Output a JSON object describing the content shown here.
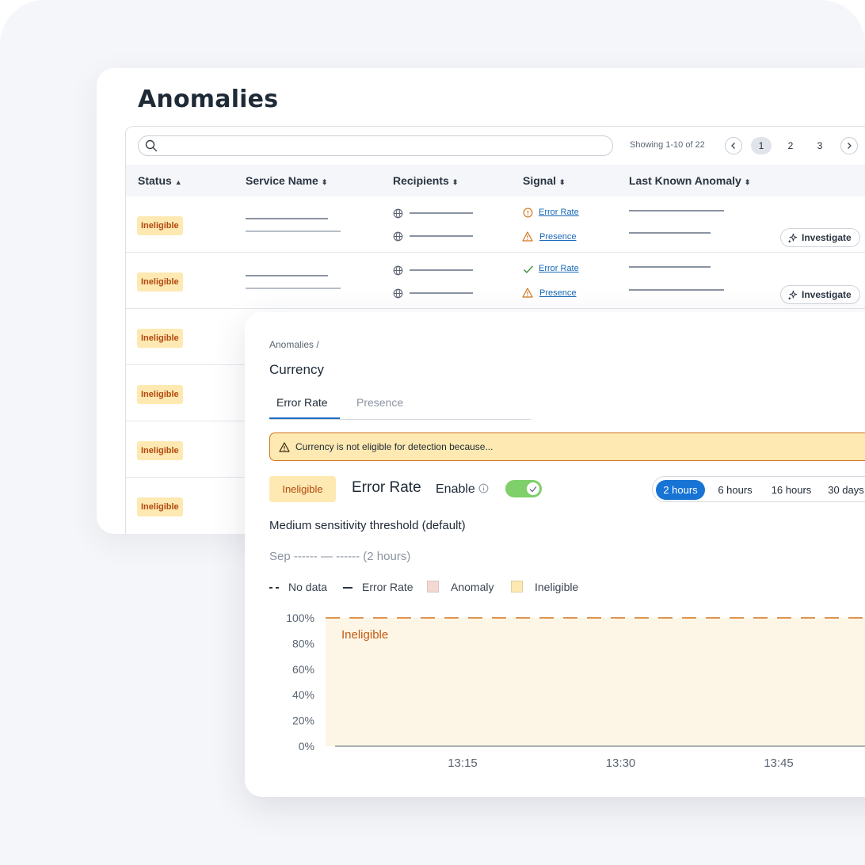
{
  "page": {
    "title": "Anomalies"
  },
  "table": {
    "search_placeholder": "",
    "showing_text": "Showing 1-10 of 22",
    "pages": [
      "1",
      "2",
      "3"
    ],
    "active_page": "1",
    "columns": [
      {
        "label": "Status",
        "sort": "▲"
      },
      {
        "label": "Service Name",
        "sort": "⬍"
      },
      {
        "label": "Recipients",
        "sort": "⬍"
      },
      {
        "label": "Signal",
        "sort": "⬍"
      },
      {
        "label": "Last Known Anomaly",
        "sort": "⬍"
      }
    ],
    "rows": [
      {
        "status": "Ineligible",
        "signals": [
          {
            "icon": "info-circle-icon",
            "label": "Error Rate"
          },
          {
            "icon": "warning-triangle-icon",
            "label": "Presence"
          }
        ],
        "action": "Investigate"
      },
      {
        "status": "Ineligible",
        "signals": [
          {
            "icon": "check-icon",
            "label": "Error Rate"
          },
          {
            "icon": "warning-triangle-icon",
            "label": "Presence"
          }
        ],
        "action": "Investigate"
      },
      {
        "status": "Ineligible"
      },
      {
        "status": "Ineligible"
      },
      {
        "status": "Ineligible"
      },
      {
        "status": "Ineligible"
      }
    ]
  },
  "detail": {
    "breadcrumb": "Anomalies /",
    "title": "Currency",
    "tabs": [
      "Error Rate",
      "Presence"
    ],
    "active_tab": "Error Rate",
    "banner_text": "Currency is not eligible for detection because...",
    "status_badge": "Ineligible",
    "metric_title": "Error Rate",
    "enable_label": "Enable",
    "enabled": true,
    "time_ranges": [
      "2 hours",
      "6 hours",
      "16 hours",
      "30 days"
    ],
    "active_range": "2 hours",
    "threshold_text": "Medium sensitivity threshold (default)",
    "date_range_text": "Sep ------  —  ------ (2 hours)",
    "legend": [
      {
        "label": "No data",
        "swatch": "dashed-line"
      },
      {
        "label": "Error Rate",
        "swatch": "solid-line"
      },
      {
        "label": "Anomaly",
        "swatch": "box",
        "color": "#f4d9d2"
      },
      {
        "label": "Ineligible",
        "swatch": "box",
        "color": "#fde9b1"
      }
    ]
  },
  "colors": {
    "ineligible_bg": "#fde9b1",
    "ineligible_text": "#b34910",
    "accent": "#1773d4",
    "link": "#1669b8",
    "warning": "#d2741c",
    "success": "#7fcf6a"
  },
  "chart_data": {
    "type": "area",
    "y_ticks": [
      "100%",
      "80%",
      "60%",
      "40%",
      "20%",
      "0%"
    ],
    "ylim": [
      0,
      100
    ],
    "x_ticks": [
      "13:15",
      "13:30",
      "13:45"
    ],
    "region_label": "Ineligible",
    "regions": [
      {
        "label": "Ineligible",
        "from": "start",
        "to": "end",
        "color": "#fdf6e6"
      }
    ],
    "threshold_line": {
      "value": 100,
      "style": "dashed",
      "color": "#d2741c"
    },
    "series": [
      {
        "name": "Error Rate",
        "values": []
      }
    ]
  }
}
